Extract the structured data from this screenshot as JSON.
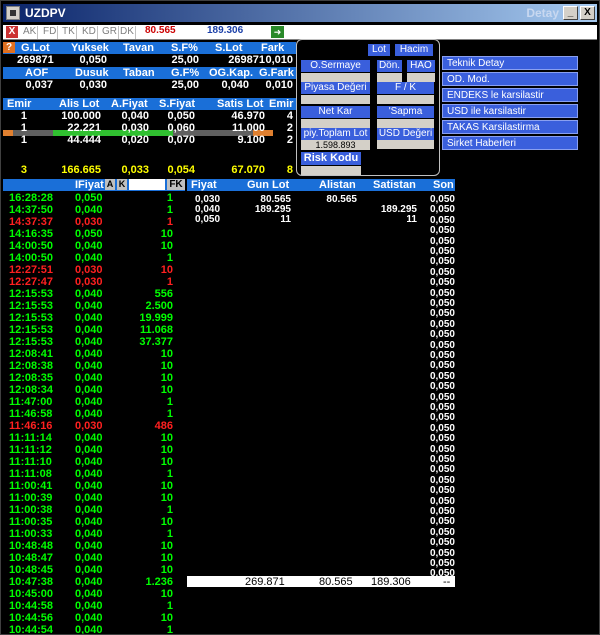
{
  "title": "UZDPV",
  "title_right": "Detay",
  "window_buttons": [
    "_",
    "□",
    "X"
  ],
  "toolbar": {
    "close": "X",
    "buttons": [
      "AK",
      "FD",
      "TK",
      "KD",
      "GR",
      "DK"
    ],
    "value1": "80.565",
    "value2": "189.306",
    "arrow": "➜"
  },
  "summary": {
    "headers1": [
      "G.Lot",
      "Yuksek",
      "Tavan",
      "S.F%",
      "S.Lot",
      "Fark"
    ],
    "values1": [
      "269871",
      "0,050",
      "25,00",
      "269871",
      "0,010"
    ],
    "headers2": [
      "AOF",
      "Dusuk",
      "Taban",
      "G.F%",
      "OG.Kap.",
      "G.Fark"
    ],
    "values2": [
      "0,037",
      "0,030",
      "25,00",
      "0,040",
      "0,010"
    ],
    "headers3": [
      "Emir",
      "Alis Lot",
      "A.Fiyat",
      "S.Fiyat",
      "Satis Lot",
      "Emir"
    ],
    "orders": [
      [
        "1",
        "100.000",
        "0,040",
        "0,050",
        "46.970",
        "4"
      ],
      [
        "1",
        "22.221",
        "0,030",
        "0,060",
        "11.000",
        "2"
      ],
      [
        "1",
        "44.444",
        "0,020",
        "0,070",
        "9.100",
        "2"
      ]
    ],
    "totals": [
      "3",
      "166.665",
      "0,033",
      "0,054",
      "67.070",
      "8"
    ]
  },
  "popup": {
    "lot": "Lot",
    "hacim": "Hacim",
    "o_sermaye": "O.Sermaye",
    "don": "Dön.",
    "hao": "HAO",
    "piyasa_degeri": "Piyasa Değeri",
    "fk": "F / K",
    "net_kar": "Net Kar",
    "sapma": "'Sapma",
    "piy_toplam_lot": "piy.Toplam Lot",
    "usd_degeri": "USD Değeri",
    "toplam_lot_value": "1.598.893",
    "risk_kodu": "Risk Kodu"
  },
  "links": [
    "Teknik Detay",
    "OD. Mod.",
    "ENDEKS le karsilastir",
    "USD ile karsilastir",
    "TAKAS Karsilastirma",
    "Sirket Haberleri"
  ],
  "trades_header": {
    "fiyat": "IFiyat",
    "a": "A",
    "k": "K",
    "fk": "FK"
  },
  "trades": [
    {
      "t": "16:28:28",
      "p": "0,050",
      "q": "1",
      "c": "#00ff00"
    },
    {
      "t": "14:37:50",
      "p": "0,040",
      "q": "1",
      "c": "#00ff00"
    },
    {
      "t": "14:37:37",
      "p": "0,030",
      "q": "1",
      "c": "#ff2020"
    },
    {
      "t": "14:16:35",
      "p": "0,050",
      "q": "10",
      "c": "#00ff00"
    },
    {
      "t": "14:00:50",
      "p": "0,040",
      "q": "10",
      "c": "#00ff00"
    },
    {
      "t": "14:00:50",
      "p": "0,040",
      "q": "1",
      "c": "#00ff00"
    },
    {
      "t": "12:27:51",
      "p": "0,030",
      "q": "10",
      "c": "#ff2020"
    },
    {
      "t": "12:27:47",
      "p": "0,030",
      "q": "1",
      "c": "#ff2020"
    },
    {
      "t": "12:15:53",
      "p": "0,040",
      "q": "556",
      "c": "#00ff00"
    },
    {
      "t": "12:15:53",
      "p": "0,040",
      "q": "2.500",
      "c": "#00ff00"
    },
    {
      "t": "12:15:53",
      "p": "0,040",
      "q": "19.999",
      "c": "#00ff00"
    },
    {
      "t": "12:15:53",
      "p": "0,040",
      "q": "11.068",
      "c": "#00ff00"
    },
    {
      "t": "12:15:53",
      "p": "0,040",
      "q": "37.377",
      "c": "#00ff00"
    },
    {
      "t": "12:08:41",
      "p": "0,040",
      "q": "10",
      "c": "#00ff00"
    },
    {
      "t": "12:08:38",
      "p": "0,040",
      "q": "10",
      "c": "#00ff00"
    },
    {
      "t": "12:08:35",
      "p": "0,040",
      "q": "10",
      "c": "#00ff00"
    },
    {
      "t": "12:08:34",
      "p": "0,040",
      "q": "10",
      "c": "#00ff00"
    },
    {
      "t": "11:47:00",
      "p": "0,040",
      "q": "1",
      "c": "#00ff00"
    },
    {
      "t": "11:46:58",
      "p": "0,040",
      "q": "1",
      "c": "#00ff00"
    },
    {
      "t": "11:46:16",
      "p": "0,030",
      "q": "486",
      "c": "#ff2020"
    },
    {
      "t": "11:11:14",
      "p": "0,040",
      "q": "10",
      "c": "#00ff00"
    },
    {
      "t": "11:11:12",
      "p": "0,040",
      "q": "10",
      "c": "#00ff00"
    },
    {
      "t": "11:11:10",
      "p": "0,040",
      "q": "10",
      "c": "#00ff00"
    },
    {
      "t": "11:11:08",
      "p": "0,040",
      "q": "1",
      "c": "#00ff00"
    },
    {
      "t": "11:00:41",
      "p": "0,040",
      "q": "10",
      "c": "#00ff00"
    },
    {
      "t": "11:00:39",
      "p": "0,040",
      "q": "10",
      "c": "#00ff00"
    },
    {
      "t": "11:00:38",
      "p": "0,040",
      "q": "1",
      "c": "#00ff00"
    },
    {
      "t": "11:00:35",
      "p": "0,040",
      "q": "10",
      "c": "#00ff00"
    },
    {
      "t": "11:00:33",
      "p": "0,040",
      "q": "1",
      "c": "#00ff00"
    },
    {
      "t": "10:48:48",
      "p": "0,040",
      "q": "10",
      "c": "#00ff00"
    },
    {
      "t": "10:48:47",
      "p": "0,040",
      "q": "10",
      "c": "#00ff00"
    },
    {
      "t": "10:48:45",
      "p": "0,040",
      "q": "10",
      "c": "#00ff00"
    },
    {
      "t": "10:47:38",
      "p": "0,040",
      "q": "1.236",
      "c": "#00ff00"
    },
    {
      "t": "10:45:00",
      "p": "0,040",
      "q": "10",
      "c": "#00ff00"
    },
    {
      "t": "10:44:58",
      "p": "0,040",
      "q": "1",
      "c": "#00ff00"
    },
    {
      "t": "10:44:56",
      "p": "0,040",
      "q": "10",
      "c": "#00ff00"
    },
    {
      "t": "10:44:54",
      "p": "0,040",
      "q": "1",
      "c": "#00ff00"
    }
  ],
  "depth_header": [
    "Fiyat",
    "Gun Lot",
    "Alistan",
    "Satistan",
    "Son"
  ],
  "depth": [
    {
      "f": "0,030",
      "g": "80.565",
      "a": "80.565",
      "s": ""
    },
    {
      "f": "0,040",
      "g": "189.295",
      "a": "",
      "s": "189.295"
    },
    {
      "f": "0,050",
      "g": "11",
      "a": "",
      "s": "11"
    }
  ],
  "son_value": "0,050",
  "son_count": 37,
  "depth_totals": {
    "g": "269.871",
    "a": "80.565",
    "s": "189.306",
    "dash": "--"
  }
}
